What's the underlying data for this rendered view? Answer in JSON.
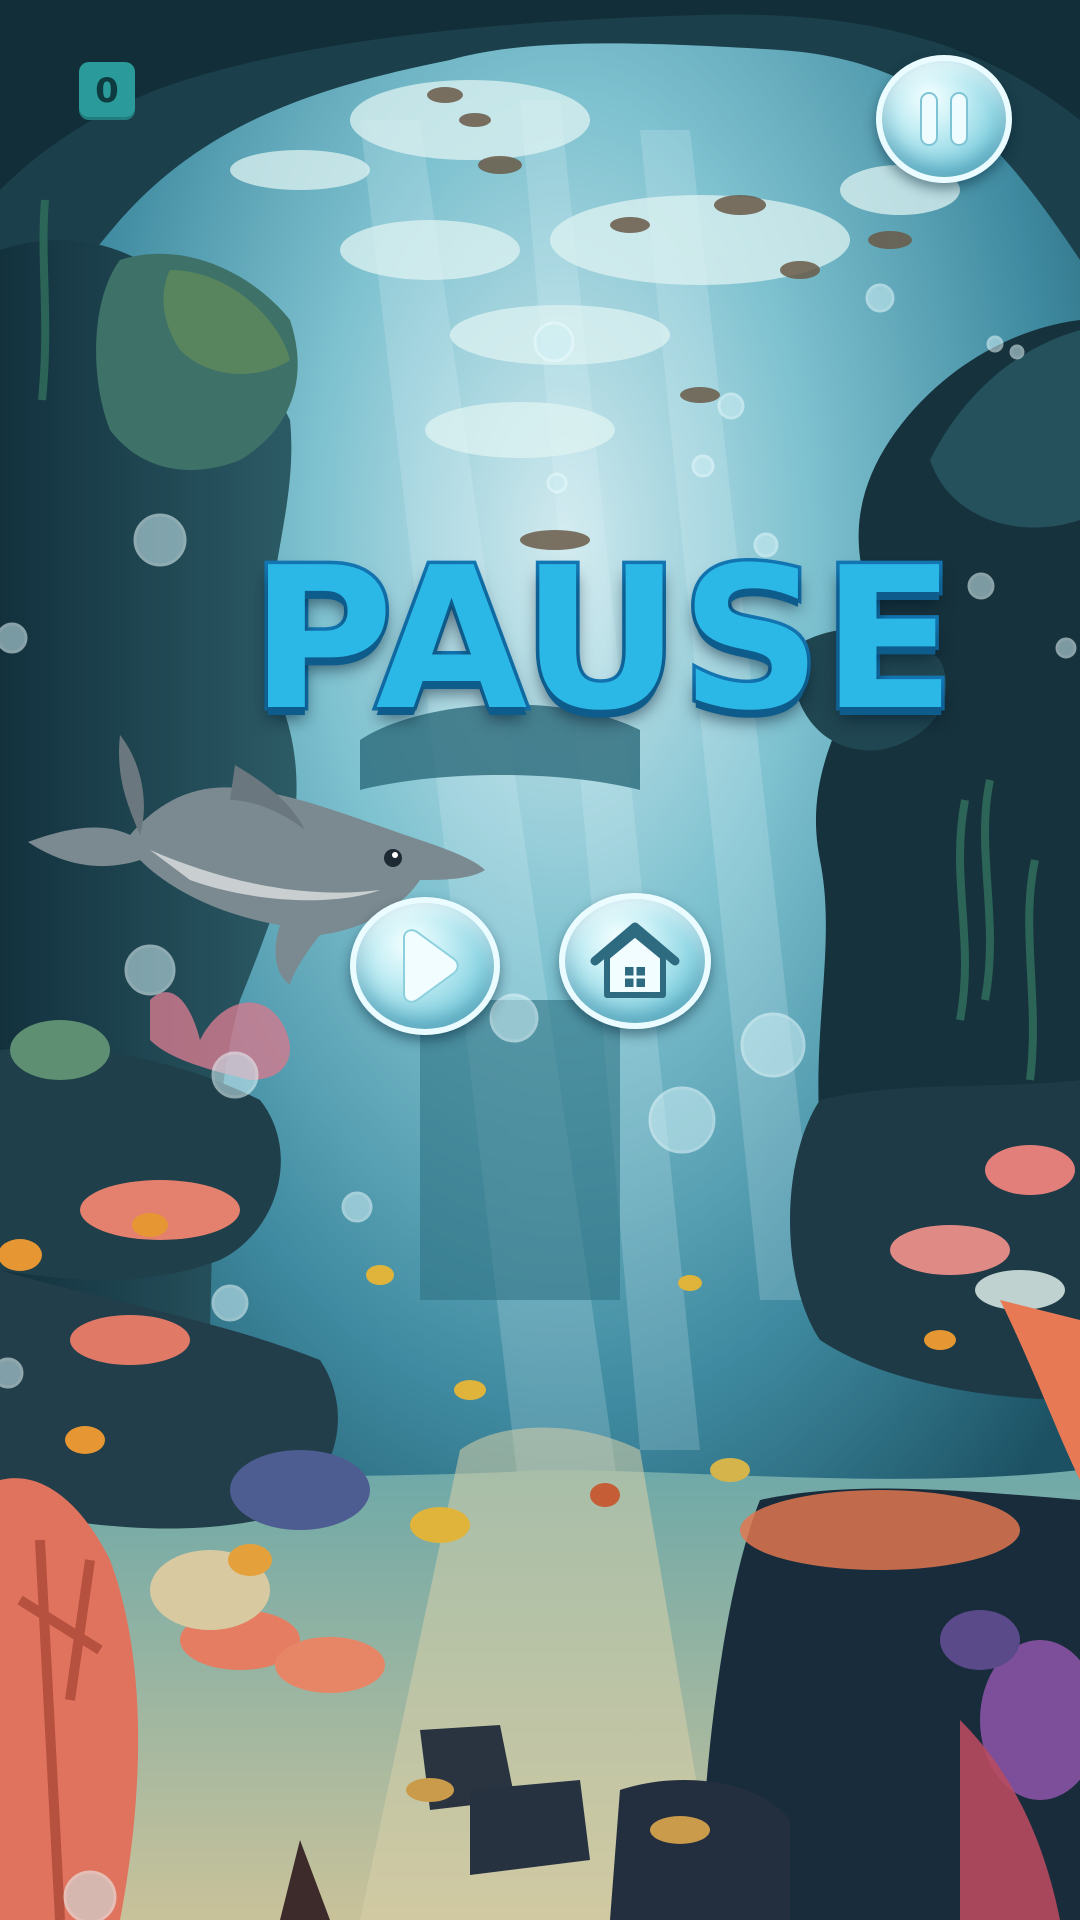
{
  "hud": {
    "score_value": "0"
  },
  "pause_menu": {
    "title": "PAUSE",
    "resume_icon": "play-icon",
    "home_icon": "home-icon"
  },
  "controls": {
    "pause_icon": "pause-icon"
  },
  "theme": {
    "title_fill": "#2bb8e6",
    "title_outline": "#1377b4",
    "badge_color": "#2a9a9a",
    "bubble_color": "#8fd6e4",
    "water_color": "#4a9fb4"
  }
}
